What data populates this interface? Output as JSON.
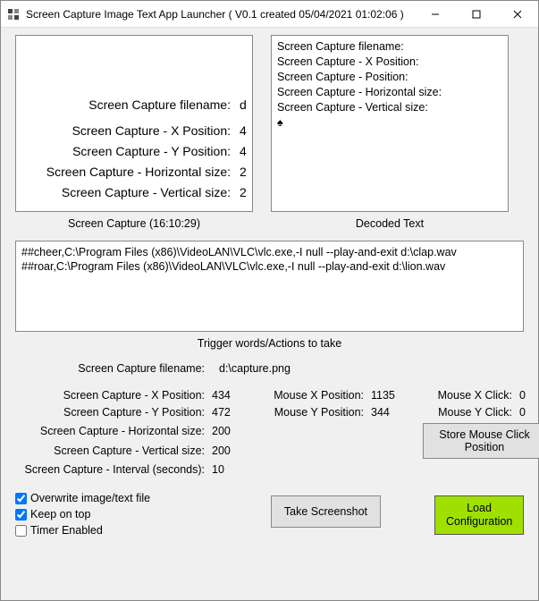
{
  "window": {
    "title": "Screen Capture Image Text App Launcher ( V0.1 created 05/04/2021 01:02:06 )"
  },
  "capture_preview": {
    "lines": [
      {
        "label": "Screen Capture filename:",
        "val": "d"
      },
      {
        "label": "Screen Capture - X Position:",
        "val": "4"
      },
      {
        "label": "Screen Capture - Y Position:",
        "val": "4"
      },
      {
        "label": "Screen Capture - Horizontal size:",
        "val": "2"
      },
      {
        "label": "Screen Capture - Vertical size:",
        "val": "2"
      }
    ],
    "caption": "Screen Capture (16:10:29)"
  },
  "decoded": {
    "lines": [
      "Screen Capture filename:",
      "",
      "Screen Capture - X Position:",
      "Screen Capture - Position:",
      "Screen Capture - Horizontal size:",
      "Screen Capture - Vertical size:",
      "♠"
    ],
    "caption": "Decoded Text"
  },
  "triggers": {
    "lines": [
      "##cheer,C:\\Program Files (x86)\\VideoLAN\\VLC\\vlc.exe,-I null --play-and-exit d:\\clap.wav",
      "##roar,C:\\Program Files (x86)\\VideoLAN\\VLC\\vlc.exe,-I null --play-and-exit d:\\lion.wav"
    ],
    "caption": "Trigger words/Actions to take"
  },
  "filename": {
    "label": "Screen Capture filename:",
    "value": "d:\\capture.png"
  },
  "settings": {
    "rows": [
      {
        "l1": "Screen Capture - X Position:",
        "v1": "434",
        "l2": "Mouse X Position:",
        "v2": "1135",
        "l3": "Mouse X Click:",
        "v3": "0"
      },
      {
        "l1": "Screen Capture - Y Position:",
        "v1": "472",
        "l2": "Mouse Y Position:",
        "v2": "344",
        "l3": "Mouse Y Click:",
        "v3": "0"
      },
      {
        "l1": "Screen Capture - Horizontal size:",
        "v1": "200",
        "l2": "",
        "v2": "",
        "l3": "",
        "v3": ""
      },
      {
        "l1": "Screen Capture - Vertical size:",
        "v1": "200",
        "l2": "",
        "v2": "",
        "l3": "",
        "v3": ""
      },
      {
        "l1": "Screen Capture - Interval (seconds):",
        "v1": "10",
        "l2": "",
        "v2": "",
        "l3": "",
        "v3": ""
      }
    ],
    "store_button": "Store Mouse Click Position"
  },
  "checks": {
    "overwrite": {
      "label": "Overwrite image/text file",
      "checked": true
    },
    "keepontop": {
      "label": "Keep on top",
      "checked": true
    },
    "timer": {
      "label": "Timer Enabled",
      "checked": false
    }
  },
  "buttons": {
    "take": "Take Screenshot",
    "load": "Load Configuration"
  }
}
